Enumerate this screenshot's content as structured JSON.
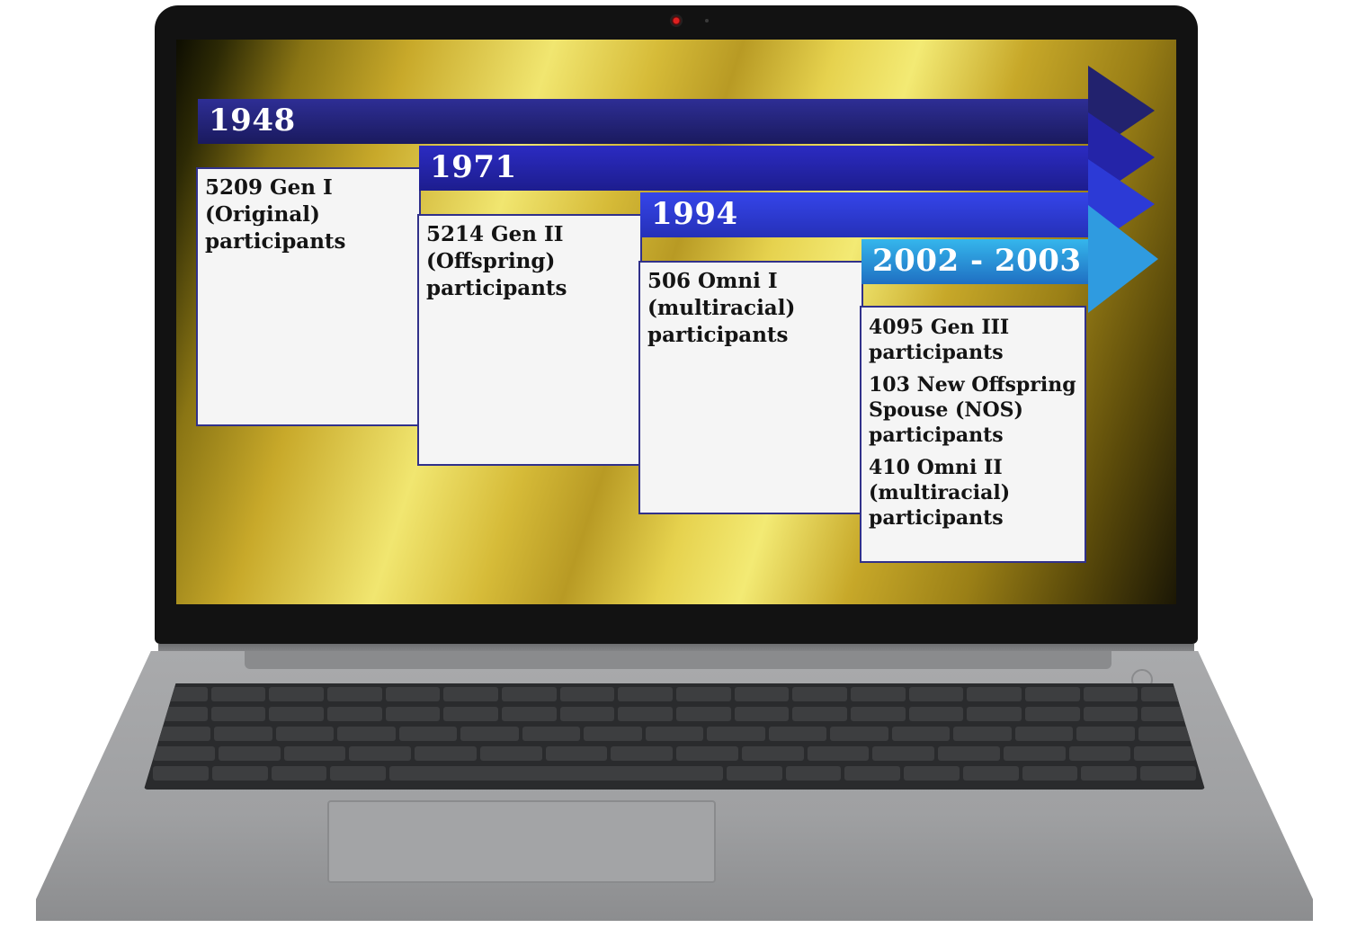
{
  "timeline": [
    {
      "year": "1948",
      "entries": [
        "5209 Gen I (Original) participants"
      ],
      "color": "#2a2a86"
    },
    {
      "year": "1971",
      "entries": [
        "5214 Gen II (Offspring) participants"
      ],
      "color": "#2525b0"
    },
    {
      "year": "1994",
      "entries": [
        "506 Omni I (multiracial) participants"
      ],
      "color": "#2b38d8"
    },
    {
      "year": "2002 - 2003",
      "entries": [
        "4095 Gen III participants",
        "103 New Offspring Spouse (NOS) participants",
        "410 Omni II (multiracial) participants"
      ],
      "color": "#2e8fd6"
    }
  ]
}
